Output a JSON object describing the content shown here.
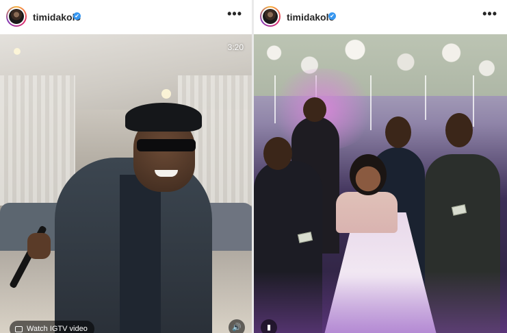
{
  "posts": [
    {
      "username": "timidakolo",
      "verified_icon": "✔",
      "more_icon": "•••",
      "duration": "3:20",
      "igtv_label": "Watch IGTV video",
      "sound_icon": "🔊"
    },
    {
      "username": "timidakolo",
      "verified_icon": "✔",
      "more_icon": "•••",
      "media_icon": "▮"
    }
  ],
  "colors": {
    "verified_blue": "#3897f0",
    "text": "#262626",
    "avatar_ring": "#e1306c"
  }
}
